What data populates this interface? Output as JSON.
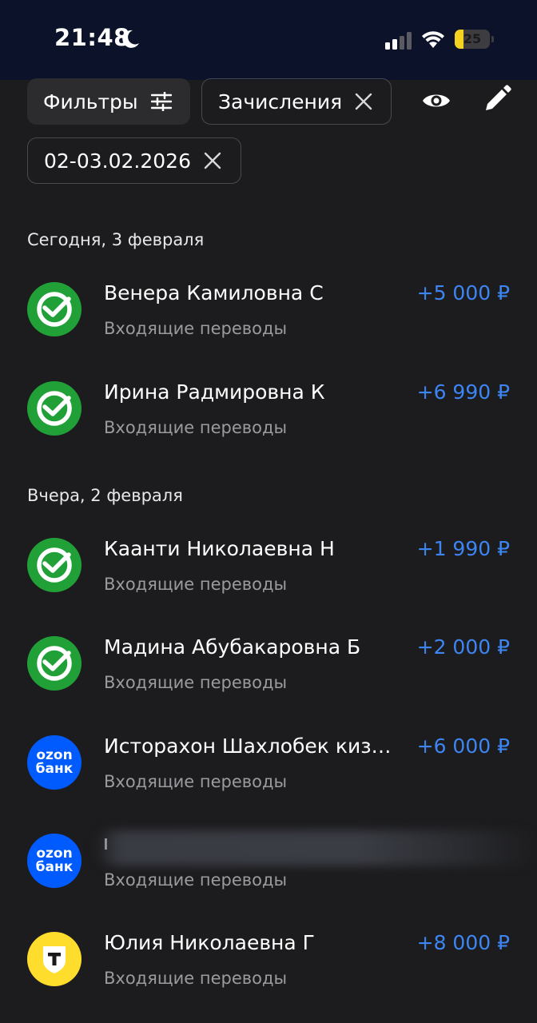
{
  "status_bar": {
    "time": "21:48",
    "battery_level": "25",
    "battery_fraction": 0.25,
    "icons": [
      "moon-icon",
      "signal-icon",
      "wifi-icon",
      "battery-icon"
    ]
  },
  "filters": {
    "filters_label": "Фильтры",
    "type_chip_label": "Зачисления",
    "date_chip_label": "02-03.02.2026",
    "icons": [
      "sliders-icon",
      "close-icon",
      "eye-icon",
      "pencil-icon"
    ]
  },
  "sections": [
    {
      "title": "Сегодня, 3 февраля",
      "transactions": [
        {
          "name": "Венера Камиловна С",
          "category": "Входящие переводы",
          "amount": "+5 000 ₽",
          "logo": "sber-logo"
        },
        {
          "name": "Ирина Радмировна К",
          "category": "Входящие переводы",
          "amount": "+6 990 ₽",
          "logo": "sber-logo"
        }
      ]
    },
    {
      "title": "Вчера, 2 февраля",
      "transactions": [
        {
          "name": "Кaанти Николаевна Н",
          "category": "Входящие переводы",
          "amount": "+1 990 ₽",
          "logo": "sber-logo"
        },
        {
          "name": "Мадина Абубакаровна Б",
          "category": "Входящие переводы",
          "amount": "+2 000 ₽",
          "logo": "sber-logo"
        },
        {
          "name": "Исторахон Шахлобек киз…",
          "category": "Входящие переводы",
          "amount": "+6 000 ₽",
          "logo": "ozon-logo",
          "logo_text_1": "ozon",
          "logo_text_2": "банк"
        },
        {
          "name": "",
          "category": "Входящие переводы",
          "amount": "",
          "logo": "ozon-logo",
          "logo_text_1": "ozon",
          "logo_text_2": "банк",
          "redacted": true
        },
        {
          "name": "Юлия Николаевна Г",
          "category": "Входящие переводы",
          "amount": "+8 000 ₽",
          "logo": "tbank-logo"
        }
      ]
    }
  ],
  "colors": {
    "background": "#1c1c1e",
    "status_bar": "#0c1229",
    "amount_blue": "#3c85f2",
    "sber_green": "#21a038",
    "ozon_blue": "#005bff",
    "tbank_yellow": "#ffdd2d",
    "battery_yellow": "#f5d21f"
  }
}
